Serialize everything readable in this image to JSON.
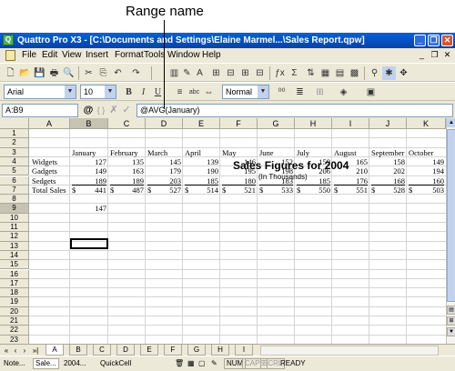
{
  "callout": {
    "label": "Range name"
  },
  "window": {
    "title": "Quattro Pro X3 - [C:\\Documents and Settings\\Elaine Marmel...\\Sales Report.qpw]",
    "app_icon_letter": "Q",
    "minimize": "_",
    "restore": "❐",
    "close": "✕"
  },
  "menu": {
    "items": [
      "File",
      "Edit",
      "View",
      "Insert",
      "Format",
      "Tools",
      "Window",
      "Help"
    ],
    "mdi_min": "_",
    "mdi_restore": "❐",
    "mdi_close": "✕"
  },
  "format_bar": {
    "font": "Arial",
    "size": "10",
    "style": "Normal",
    "bold": "B",
    "italic": "I",
    "underline": "U"
  },
  "input_line": {
    "cell_address": "A:B9",
    "at_symbol": "@",
    "braces": "{ }",
    "cancel": "✗",
    "confirm": "✓",
    "formula": "@AVG(January)"
  },
  "sheet": {
    "columns": [
      "A",
      "B",
      "C",
      "D",
      "E",
      "F",
      "G",
      "H",
      "I",
      "J",
      "K"
    ],
    "rows": [
      "1",
      "2",
      "3",
      "4",
      "5",
      "6",
      "7",
      "8",
      "9",
      "10",
      "11",
      "12",
      "13",
      "14",
      "15",
      "16",
      "17",
      "18",
      "19",
      "20",
      "21",
      "22",
      "23"
    ],
    "title": "Sales Figures for 2004",
    "subtitle": "(In Thousands)",
    "months": [
      "January",
      "February",
      "March",
      "April",
      "May",
      "June",
      "July",
      "August",
      "September",
      "October"
    ],
    "data_rows": [
      {
        "label": "Widgets",
        "values": [
          "127",
          "135",
          "145",
          "139",
          "146",
          "152",
          "159",
          "165",
          "158",
          "149"
        ]
      },
      {
        "label": "Gadgets",
        "values": [
          "149",
          "163",
          "179",
          "190",
          "195",
          "198",
          "206",
          "210",
          "202",
          "194"
        ]
      },
      {
        "label": "Sedgets",
        "values": [
          "189",
          "189",
          "203",
          "185",
          "180",
          "183",
          "185",
          "176",
          "168",
          "160"
        ]
      }
    ],
    "total": {
      "label": "Total Sales",
      "currency": "$",
      "values": [
        "441",
        "487",
        "527",
        "514",
        "521",
        "533",
        "550",
        "551",
        "528",
        "503"
      ]
    },
    "active_value": "147"
  },
  "tabs": {
    "items": [
      "A",
      "B",
      "C",
      "D",
      "E",
      "F",
      "G",
      "H",
      "I"
    ],
    "active": "A",
    "nav": [
      "«",
      "‹",
      "›",
      "»|"
    ]
  },
  "status": {
    "doc_short": "Note...",
    "sale_short": "Sale...",
    "year": "2004...",
    "quickcell": "QuickCell",
    "num": "NUM",
    "caps": "CAPS",
    "scrl": "SCRL",
    "ready": "READY"
  },
  "colors": {
    "title_bar": "#0a5fd8",
    "close_button": "#d9532c",
    "chrome": "#ece9d8"
  }
}
